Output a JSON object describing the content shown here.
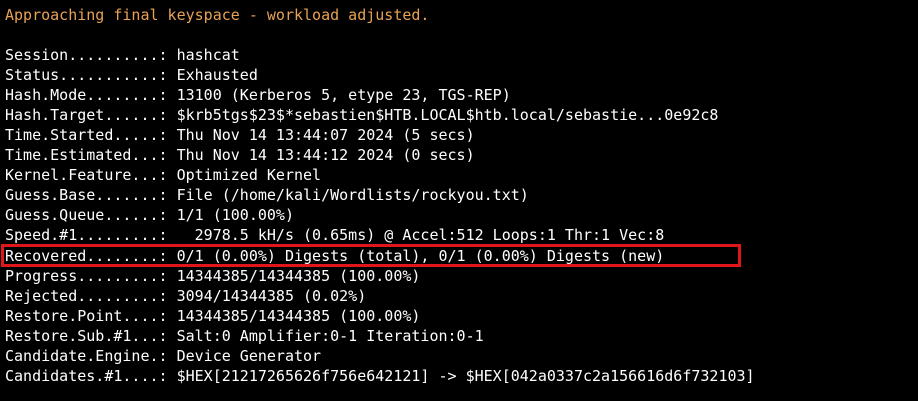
{
  "terminal": {
    "warning": "Approaching final keyspace - workload adjusted.",
    "highlight_color": "#e0161b",
    "warning_color": "#e8a155",
    "lines": [
      {
        "key": "Session..........: ",
        "value": "hashcat"
      },
      {
        "key": "Status...........: ",
        "value": "Exhausted"
      },
      {
        "key": "Hash.Mode........: ",
        "value": "13100 (Kerberos 5, etype 23, TGS-REP)"
      },
      {
        "key": "Hash.Target......: ",
        "value": "$krb5tgs$23$*sebastien$HTB.LOCAL$htb.local/sebastie...0e92c8"
      },
      {
        "key": "Time.Started.....: ",
        "value": "Thu Nov 14 13:44:07 2024 (5 secs)"
      },
      {
        "key": "Time.Estimated...: ",
        "value": "Thu Nov 14 13:44:12 2024 (0 secs)"
      },
      {
        "key": "Kernel.Feature...: ",
        "value": "Optimized Kernel"
      },
      {
        "key": "Guess.Base.......: ",
        "value": "File (/home/kali/Wordlists/rockyou.txt)"
      },
      {
        "key": "Guess.Queue......: ",
        "value": "1/1 (100.00%)"
      },
      {
        "key": "Speed.#1.........: ",
        "value": "  2978.5 kH/s (0.65ms) @ Accel:512 Loops:1 Thr:1 Vec:8"
      },
      {
        "key": "Recovered........: ",
        "value": "0/1 (0.00%) Digests (total), 0/1 (0.00%) Digests (new)"
      },
      {
        "key": "Progress.........: ",
        "value": "14344385/14344385 (100.00%)"
      },
      {
        "key": "Rejected.........: ",
        "value": "3094/14344385 (0.02%)"
      },
      {
        "key": "Restore.Point....: ",
        "value": "14344385/14344385 (100.00%)"
      },
      {
        "key": "Restore.Sub.#1...: ",
        "value": "Salt:0 Amplifier:0-1 Iteration:0-1"
      },
      {
        "key": "Candidate.Engine.: ",
        "value": "Device Generator"
      },
      {
        "key": "Candidates.#1....: ",
        "value": "$HEX[21217265626f756e642121] -> $HEX[042a0337c2a156616d6f732103]"
      }
    ]
  }
}
